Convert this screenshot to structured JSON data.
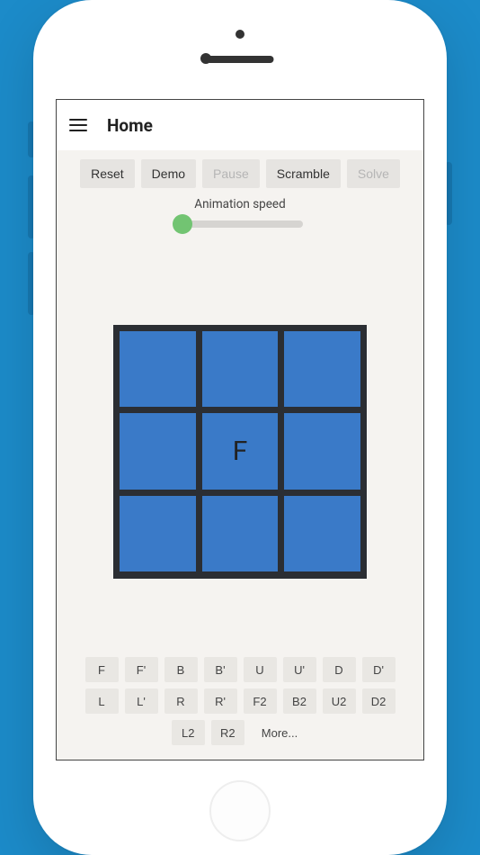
{
  "header": {
    "title": "Home"
  },
  "toolbar": {
    "reset": "Reset",
    "demo": "Demo",
    "pause": "Pause",
    "scramble": "Scramble",
    "solve": "Solve"
  },
  "slider": {
    "label": "Animation speed",
    "value": 0
  },
  "cube": {
    "center_label": "F",
    "face_color": "#3a7ac8"
  },
  "moves": {
    "row1": [
      "F",
      "F'",
      "B",
      "B'",
      "U",
      "U'",
      "D",
      "D'"
    ],
    "row2": [
      "L",
      "L'",
      "R",
      "R'",
      "F2",
      "B2",
      "U2",
      "D2"
    ],
    "row3": [
      "L2",
      "R2"
    ],
    "more": "More..."
  }
}
